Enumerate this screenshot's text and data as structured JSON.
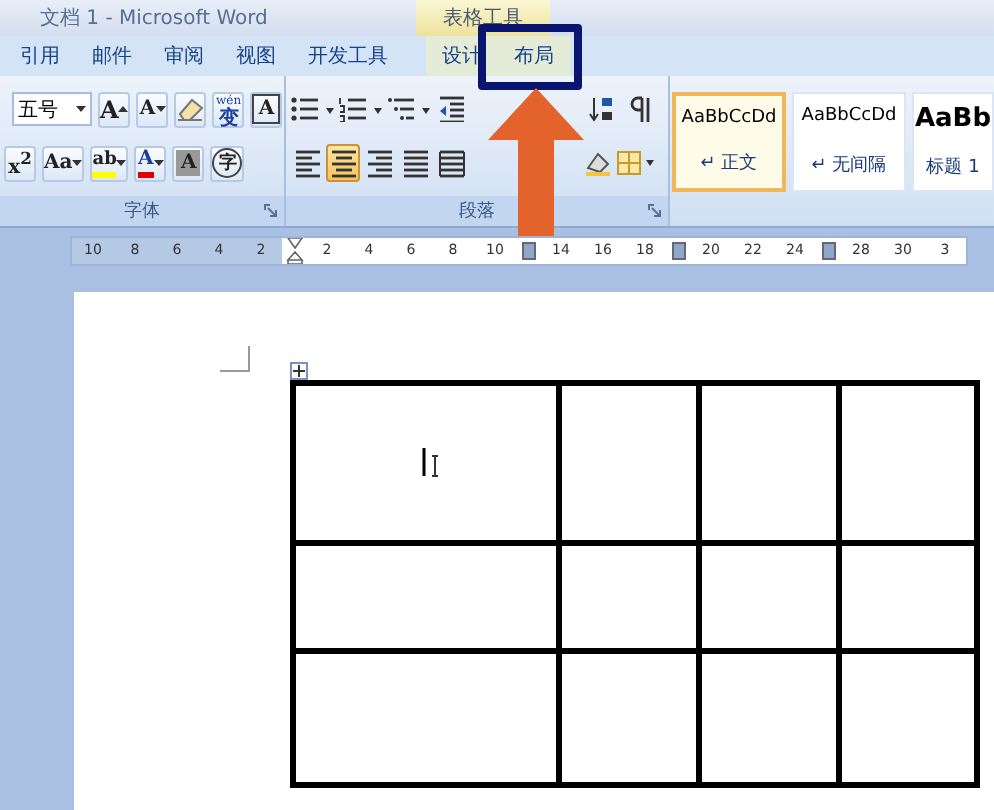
{
  "window": {
    "title": "文档 1 - Microsoft Word"
  },
  "contextual_group": {
    "label": "表格工具"
  },
  "tabs": [
    {
      "label": "引用",
      "contextual": false,
      "highlighted": false
    },
    {
      "label": "邮件",
      "contextual": false,
      "highlighted": false
    },
    {
      "label": "审阅",
      "contextual": false,
      "highlighted": false
    },
    {
      "label": "视图",
      "contextual": false,
      "highlighted": false
    },
    {
      "label": "开发工具",
      "contextual": false,
      "highlighted": false
    },
    {
      "label": "设计",
      "contextual": true,
      "highlighted": false
    },
    {
      "label": "布局",
      "contextual": true,
      "highlighted": true
    }
  ],
  "font_group": {
    "label": "字体",
    "font_size": "五号",
    "row1": [
      {
        "kind": "grow",
        "text": "A"
      },
      {
        "kind": "shrink",
        "text": "A"
      },
      {
        "kind": "eraser"
      },
      {
        "kind": "phonetic",
        "text": "变",
        "ruby": "wén"
      },
      {
        "kind": "boxed",
        "text": "A"
      }
    ],
    "row2": [
      {
        "kind": "glyph",
        "text": "x$^{2}$"
      },
      {
        "kind": "dropdown",
        "text": "Aa"
      },
      {
        "kind": "highlight",
        "text": "ab"
      },
      {
        "kind": "font-color",
        "text": "A"
      },
      {
        "kind": "shaded",
        "text": "A"
      },
      {
        "kind": "enclosed",
        "text": "字"
      }
    ]
  },
  "paragraph_group": {
    "label": "段落",
    "alignments": [
      {
        "selected": false
      },
      {
        "selected": true
      },
      {
        "selected": false
      },
      {
        "selected": false
      },
      {
        "selected": false
      }
    ]
  },
  "styles": [
    {
      "sample": "AaBbCcDd",
      "name": "↵ 正文",
      "selected": true,
      "kind": "body"
    },
    {
      "sample": "AaBbCcDd",
      "name": "↵ 无间隔",
      "selected": false,
      "kind": "body"
    },
    {
      "sample": "AaBb",
      "name": "标题 1",
      "selected": false,
      "kind": "heading"
    }
  ],
  "ruler": [
    {
      "kind": "margin-number",
      "text": "10"
    },
    {
      "kind": "margin-number",
      "text": "8"
    },
    {
      "kind": "margin-number",
      "text": "6"
    },
    {
      "kind": "margin-number",
      "text": "4"
    },
    {
      "kind": "margin-number",
      "text": "2"
    },
    {
      "kind": "indent"
    },
    {
      "kind": "number",
      "text": "2"
    },
    {
      "kind": "number",
      "text": "4"
    },
    {
      "kind": "number",
      "text": "6"
    },
    {
      "kind": "number",
      "text": "8"
    },
    {
      "kind": "number",
      "text": "10"
    },
    {
      "kind": "marker"
    },
    {
      "kind": "number",
      "text": "14"
    },
    {
      "kind": "number",
      "text": "16"
    },
    {
      "kind": "number",
      "text": "18"
    },
    {
      "kind": "marker"
    },
    {
      "kind": "number",
      "text": "20"
    },
    {
      "kind": "number",
      "text": "22"
    },
    {
      "kind": "number",
      "text": "24"
    },
    {
      "kind": "marker"
    },
    {
      "kind": "number",
      "text": "28"
    },
    {
      "kind": "number",
      "text": "30"
    },
    {
      "kind": "number",
      "text": "3"
    }
  ],
  "table": {
    "caret": true
  }
}
